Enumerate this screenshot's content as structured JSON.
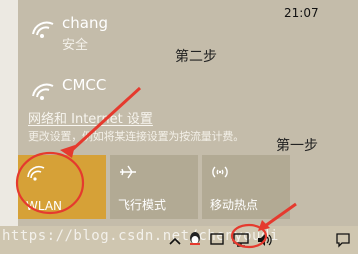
{
  "networks": [
    {
      "name": "chang",
      "status": "安全"
    },
    {
      "name": "CMCC",
      "status": ""
    }
  ],
  "settings": {
    "title": "网络和 Internet 设置",
    "description": "更改设置，例如将某连接设置为按流量计费。"
  },
  "tiles": [
    {
      "label": "WLAN",
      "icon": "wifi-icon",
      "active": true
    },
    {
      "label": "飞行模式",
      "icon": "airplane-icon",
      "active": false
    },
    {
      "label": "移动热点",
      "icon": "hotspot-icon",
      "active": false
    }
  ],
  "taskbar": {
    "time": "21:07"
  },
  "watermark": "https://blog.csdn.net/chenyoudi",
  "annotations": {
    "step1": "第一步",
    "step2": "第二步"
  },
  "colors": {
    "accent": "#d6a137",
    "annotation": "#e53a2e"
  }
}
